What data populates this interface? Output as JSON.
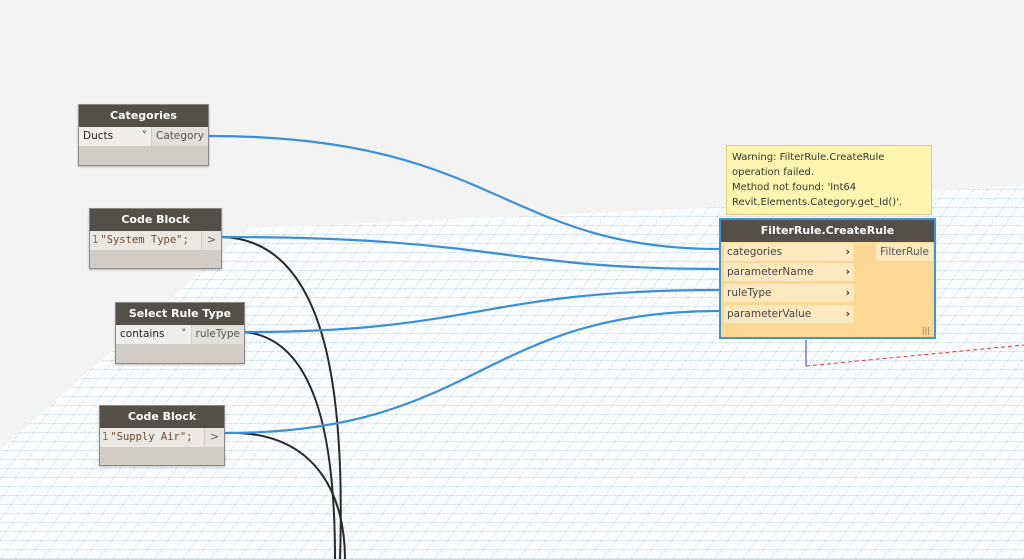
{
  "nodes": {
    "categories": {
      "title": "Categories",
      "selected": "Ducts",
      "output": "Category"
    },
    "code_block_1": {
      "title": "Code Block",
      "line": "1",
      "code": "\"System Type\";",
      "output": ">"
    },
    "select_rule_type": {
      "title": "Select Rule Type",
      "selected": "contains",
      "output": "ruleType"
    },
    "code_block_2": {
      "title": "Code Block",
      "line": "1",
      "code": "\"Supply Air\";",
      "output": ">"
    },
    "filter_rule": {
      "title": "FilterRule.CreateRule",
      "inputs": [
        "categories",
        "parameterName",
        "ruleType",
        "parameterValue"
      ],
      "output": "FilterRule",
      "lacing": "|||"
    }
  },
  "warning": {
    "line1": "Warning: FilterRule.CreateRule operation failed.",
    "line2": "Method not found: 'Int64 Revit.Elements.Category.get_Id()'."
  },
  "colors": {
    "wire": "#3a8fd8",
    "node_header": "#545049",
    "warning_node": "#fcd892"
  }
}
